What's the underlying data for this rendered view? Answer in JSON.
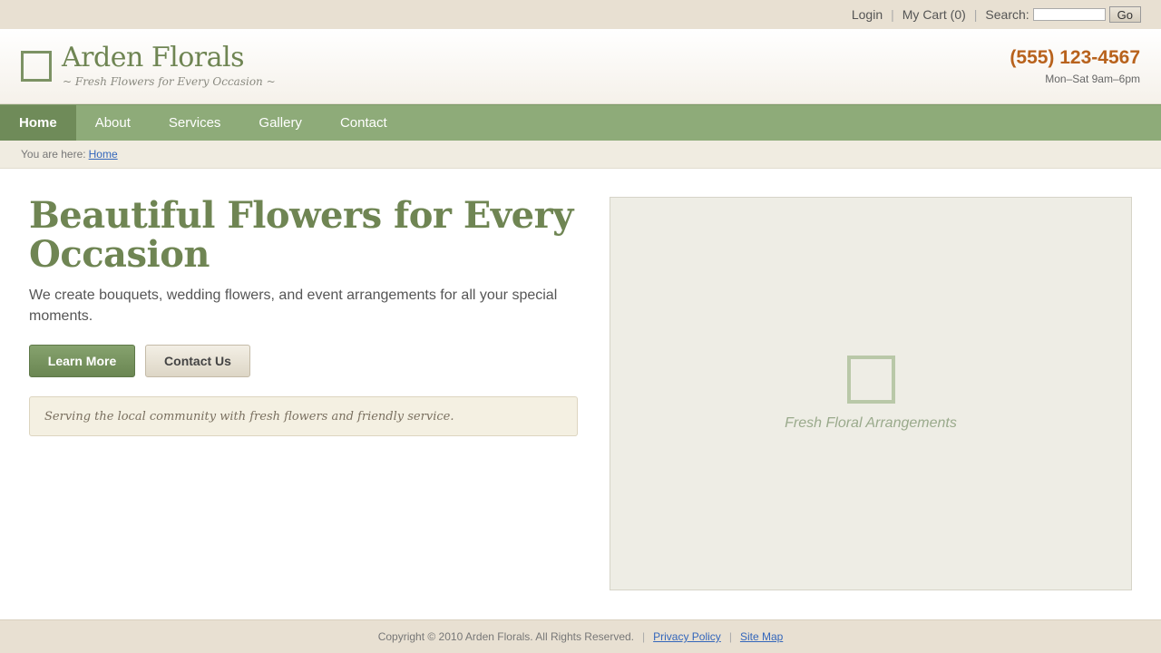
{
  "topbar": {
    "login": "Login",
    "cart": "My Cart (0)",
    "search_label": "Search:",
    "search_value": "",
    "go": "Go"
  },
  "header": {
    "brand": "Arden Florals",
    "tagline": "~ Fresh Flowers for Every Occasion ~",
    "phone": "(555) 123-4567",
    "hours": "Mon–Sat 9am–6pm"
  },
  "nav": {
    "active": "Home",
    "items": [
      {
        "label": "Home"
      },
      {
        "label": "About"
      },
      {
        "label": "Services"
      },
      {
        "label": "Gallery"
      },
      {
        "label": "Contact"
      }
    ]
  },
  "breadcrumb": {
    "prefix": "You are here:",
    "current": "Home"
  },
  "hero": {
    "title": "Beautiful Flowers for Every Occasion",
    "text": "We create bouquets, wedding flowers, and event arrangements for all your special moments.",
    "primary_button": "Learn More",
    "secondary_button": "Contact Us",
    "notice": "Serving the local community with fresh flowers and friendly service."
  },
  "image_panel": {
    "caption": "Fresh Floral Arrangements"
  },
  "footer": {
    "copyright": "Copyright © 2010 Arden Florals. All Rights Reserved.",
    "privacy": "Privacy Policy",
    "sitemap": "Site Map"
  },
  "colors": {
    "brand_green": "#6f8553",
    "nav_green": "#8eab79",
    "phone_orange": "#b8621c",
    "beige": "#e8e0d2"
  },
  "icons": {
    "logo": "square-outline-icon",
    "placeholder": "image-placeholder-icon"
  }
}
